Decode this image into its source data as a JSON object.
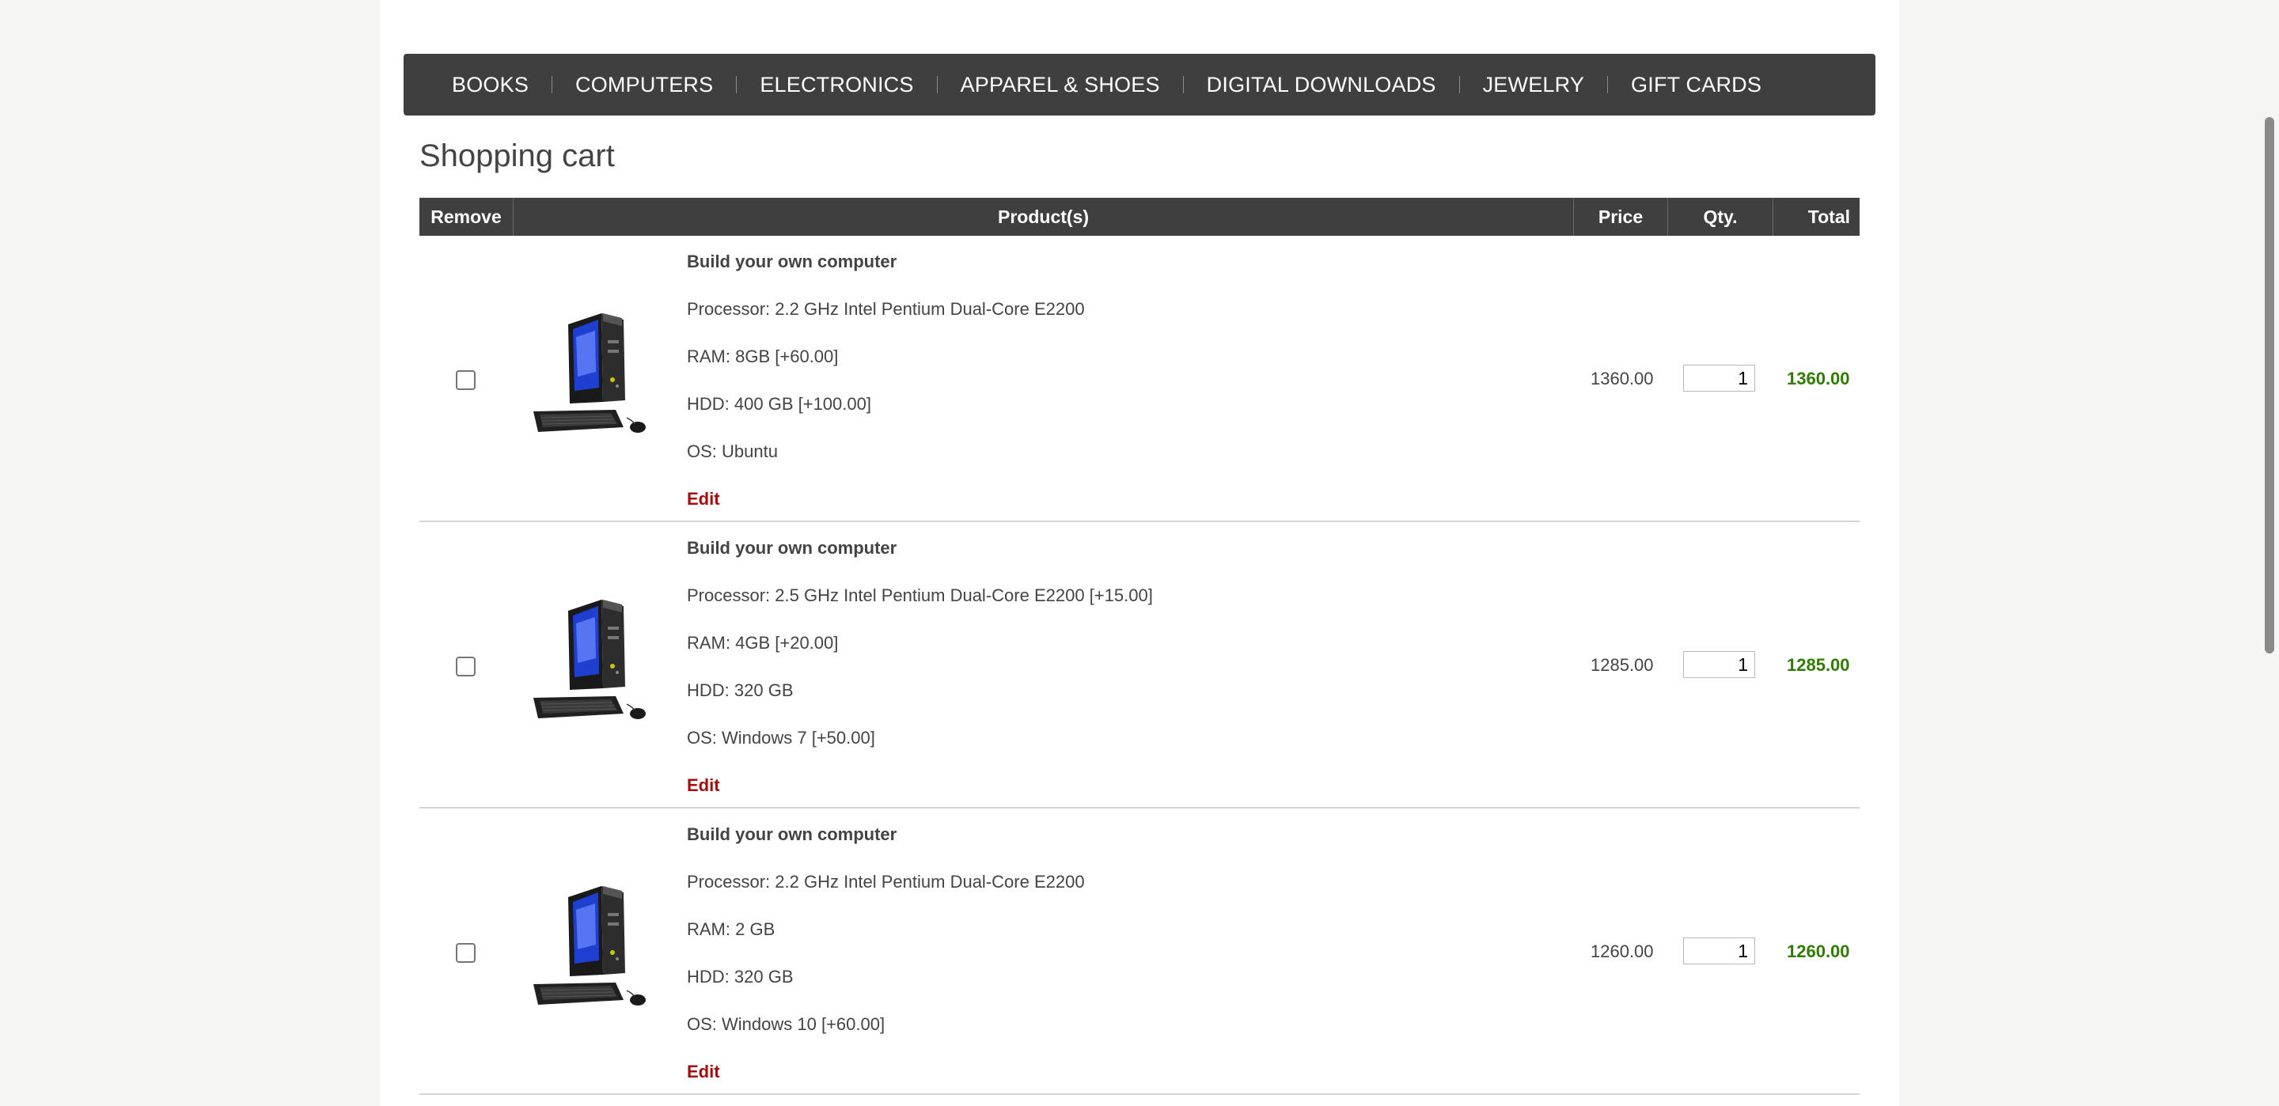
{
  "menu": {
    "items": [
      "BOOKS",
      "COMPUTERS",
      "ELECTRONICS",
      "APPAREL & SHOES",
      "DIGITAL DOWNLOADS",
      "JEWELRY",
      "GIFT CARDS"
    ]
  },
  "page_title": "Shopping cart",
  "cart": {
    "headers": {
      "remove": "Remove",
      "product": "Product(s)",
      "price": "Price",
      "qty": "Qty.",
      "total": "Total"
    },
    "edit_label": "Edit",
    "rows": [
      {
        "name": "Build your own computer",
        "attributes": [
          "Processor: 2.2 GHz Intel Pentium Dual-Core E2200",
          "RAM: 8GB [+60.00]",
          "HDD: 400 GB [+100.00]",
          "OS: Ubuntu"
        ],
        "price": "1360.00",
        "qty": "1",
        "total": "1360.00"
      },
      {
        "name": "Build your own computer",
        "attributes": [
          "Processor: 2.5 GHz Intel Pentium Dual-Core E2200 [+15.00]",
          "RAM: 4GB [+20.00]",
          "HDD: 320 GB",
          "OS: Windows 7 [+50.00]"
        ],
        "price": "1285.00",
        "qty": "1",
        "total": "1285.00"
      },
      {
        "name": "Build your own computer",
        "attributes": [
          "Processor: 2.2 GHz Intel Pentium Dual-Core E2200",
          "RAM: 2 GB",
          "HDD: 320 GB",
          "OS: Windows 10 [+60.00]"
        ],
        "price": "1260.00",
        "qty": "1",
        "total": "1260.00"
      }
    ]
  },
  "colors": {
    "menu_bg": "#3f3f3f",
    "total_green": "#2f7d00",
    "edit_red": "#a40e0e"
  }
}
